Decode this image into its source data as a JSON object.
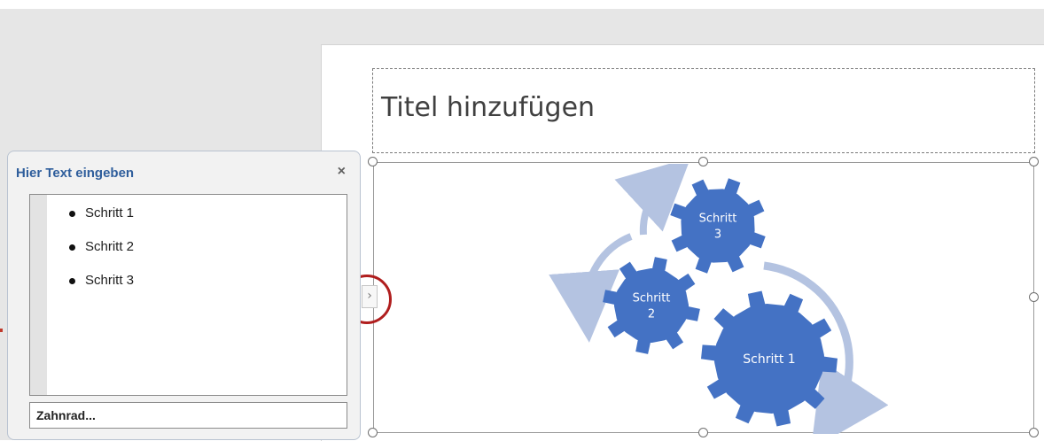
{
  "slide": {
    "title_placeholder": "Titel hinzufügen"
  },
  "smartart": {
    "gears": [
      {
        "label_lines": [
          "Schritt 1"
        ]
      },
      {
        "label_lines": [
          "Schritt",
          "2"
        ]
      },
      {
        "label_lines": [
          "Schritt",
          "3"
        ]
      }
    ],
    "gear_color": "#4472c4",
    "arrow_color": "#b4c3e1",
    "label_color": "#ffffff"
  },
  "text_pane": {
    "title": "Hier Text eingeben",
    "close_glyph": "×",
    "items": [
      "Schritt 1",
      "Schritt 2",
      "Schritt 3"
    ],
    "footer": "Zahnrad..."
  },
  "pane_toggle": {
    "glyph": "›"
  },
  "colors": {
    "annotation": "#b01e1e",
    "pane_title": "#2f5e9c"
  }
}
